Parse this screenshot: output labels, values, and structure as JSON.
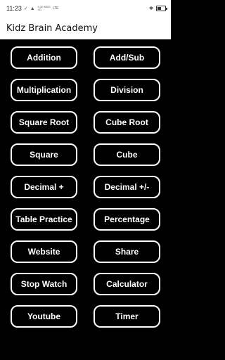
{
  "status_bar": {
    "time": "11:23",
    "network_speed": "0.30 KB/S",
    "network_type": "4G",
    "network_type2": "LTE"
  },
  "app_bar": {
    "title": "Kidz Brain Academy"
  },
  "menu": {
    "buttons": [
      {
        "label": "Addition"
      },
      {
        "label": "Add/Sub"
      },
      {
        "label": "Multiplication"
      },
      {
        "label": "Division"
      },
      {
        "label": "Square Root"
      },
      {
        "label": "Cube Root"
      },
      {
        "label": "Square"
      },
      {
        "label": "Cube"
      },
      {
        "label": "Decimal +"
      },
      {
        "label": "Decimal +/-"
      },
      {
        "label": "Table Practice"
      },
      {
        "label": "Percentage"
      },
      {
        "label": "Website"
      },
      {
        "label": "Share"
      },
      {
        "label": "Stop Watch"
      },
      {
        "label": "Calculator"
      },
      {
        "label": "Youtube"
      },
      {
        "label": "Timer"
      }
    ]
  },
  "colors": {
    "background": "#000000",
    "button_border": "#ffffff",
    "button_text": "#ffffff",
    "app_bar": "#ffffff"
  }
}
